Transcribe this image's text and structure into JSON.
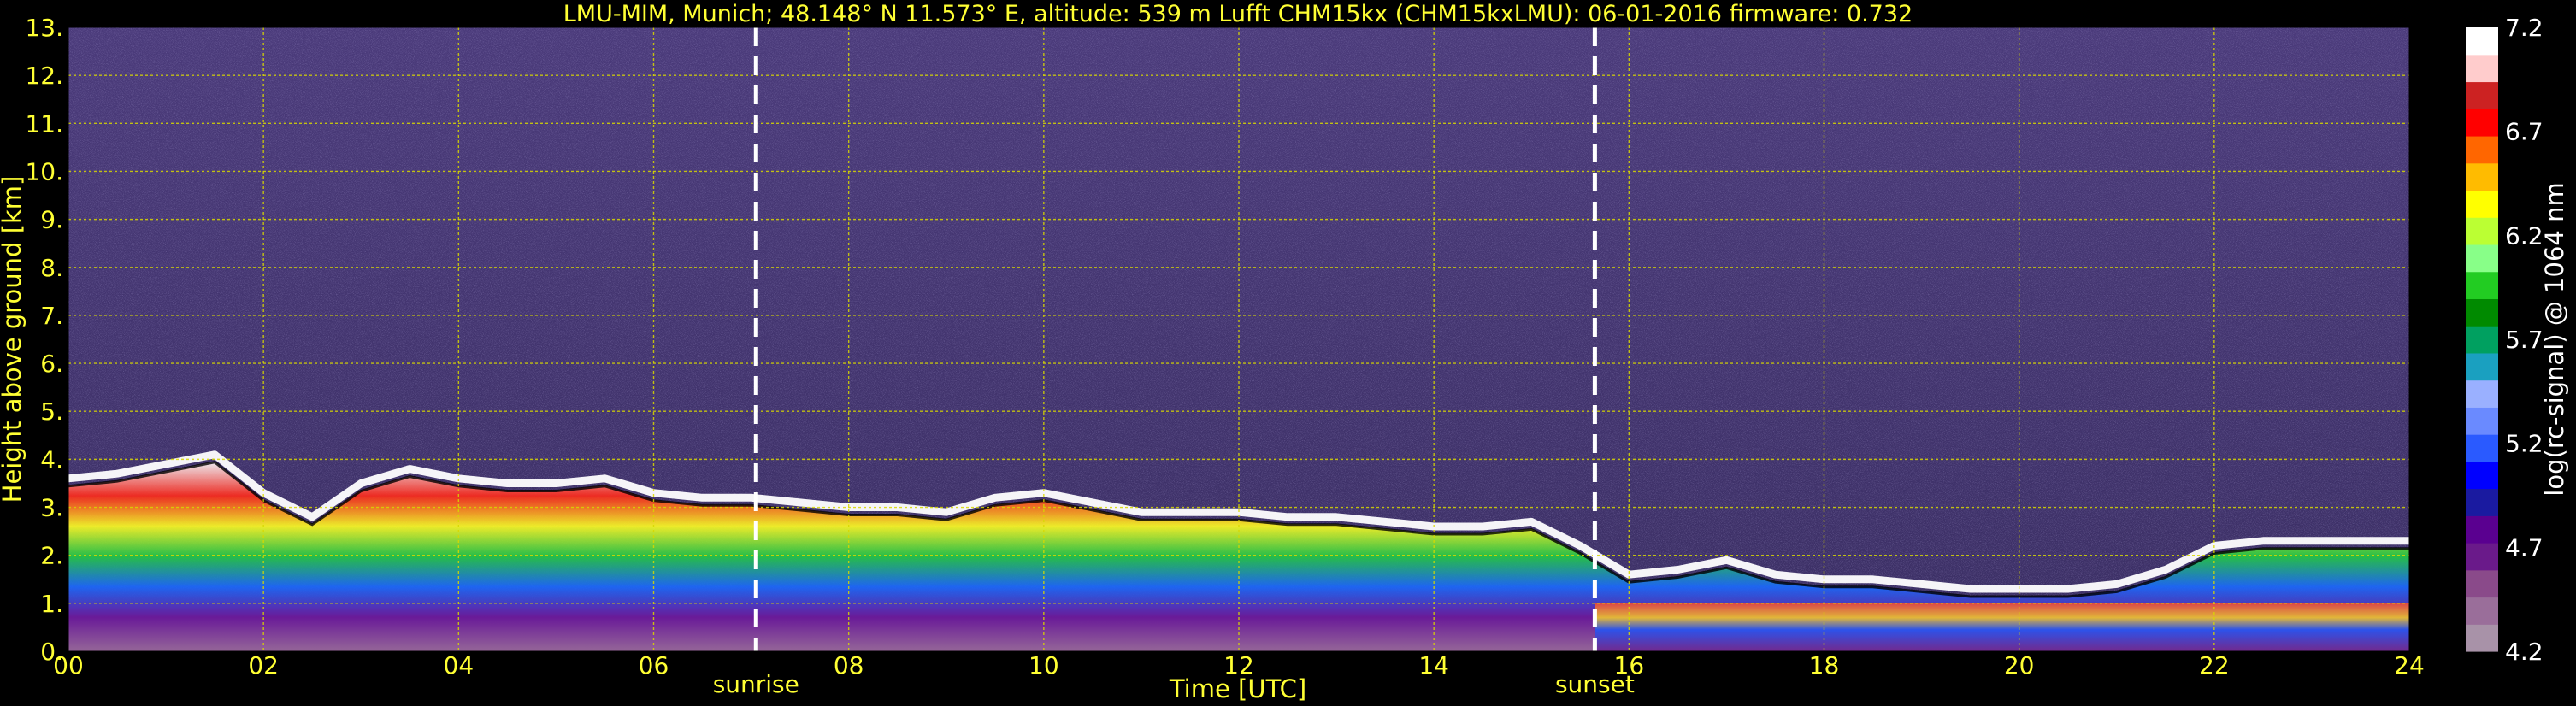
{
  "title": "LMU-MIM, Munich; 48.148° N 11.573° E, altitude: 539 m    Lufft CHM15kx (CHM15kxLMU): 06-01-2016    firmware: 0.732",
  "chart_data": {
    "type": "heatmap",
    "xlabel": "Time [UTC]",
    "ylabel": "Height above ground [km]",
    "xlim": [
      0,
      24
    ],
    "ylim": [
      0,
      13
    ],
    "x_ticks": [
      "00",
      "02",
      "04",
      "06",
      "08",
      "10",
      "12",
      "14",
      "16",
      "18",
      "20",
      "22",
      "24"
    ],
    "y_ticks": [
      "0.",
      "1.",
      "2.",
      "3.",
      "4.",
      "5.",
      "6.",
      "7.",
      "8.",
      "9.",
      "10.",
      "11.",
      "12.",
      "13."
    ],
    "grid": true,
    "events": [
      {
        "label": "sunrise",
        "time": 7.05
      },
      {
        "label": "sunset",
        "time": 15.65
      }
    ],
    "colorbar": {
      "label": "log(rc-signal) @ 1064 nm",
      "range": [
        4.2,
        7.2
      ],
      "ticks": [
        "4.2",
        "4.7",
        "5.2",
        "5.7",
        "6.2",
        "6.7",
        "7.2"
      ],
      "colors": [
        "#a892a8",
        "#9a6e9a",
        "#8a4a8a",
        "#6a1a8a",
        "#5a0090",
        "#1a1aa0",
        "#0000ff",
        "#2a5aff",
        "#6a8aff",
        "#9ab0ff",
        "#1aa0c0",
        "#00a060",
        "#008a00",
        "#22cc22",
        "#88ff88",
        "#bbff33",
        "#ffff00",
        "#ffbb00",
        "#ff6600",
        "#ff0000",
        "#cc2222",
        "#ffcccc",
        "#ffffff"
      ]
    },
    "series": [
      {
        "kind": "cloud_top",
        "x": [
          0,
          0.5,
          1,
          1.5,
          2,
          2.5,
          3,
          3.5,
          4,
          4.5,
          5,
          5.5,
          6,
          6.5,
          7,
          7.5,
          8,
          8.5,
          9,
          9.5,
          10,
          10.5,
          11,
          11.5,
          12,
          12.5,
          13,
          13.5,
          14,
          14.5,
          15,
          15.5,
          16,
          16.5,
          17,
          17.5,
          18,
          18.5,
          19,
          19.5,
          20,
          20.5,
          21,
          21.5,
          22,
          22.5,
          23,
          23.5,
          24
        ],
        "values": [
          3.6,
          3.7,
          3.9,
          4.1,
          3.3,
          2.8,
          3.5,
          3.8,
          3.6,
          3.5,
          3.5,
          3.6,
          3.3,
          3.2,
          3.2,
          3.1,
          3.0,
          3.0,
          2.9,
          3.2,
          3.3,
          3.1,
          2.9,
          2.9,
          2.9,
          2.8,
          2.8,
          2.7,
          2.6,
          2.6,
          2.7,
          2.2,
          1.6,
          1.7,
          1.9,
          1.6,
          1.5,
          1.5,
          1.4,
          1.3,
          1.3,
          1.3,
          1.4,
          1.7,
          2.2,
          2.3,
          2.3,
          2.3,
          2.3
        ]
      }
    ]
  }
}
